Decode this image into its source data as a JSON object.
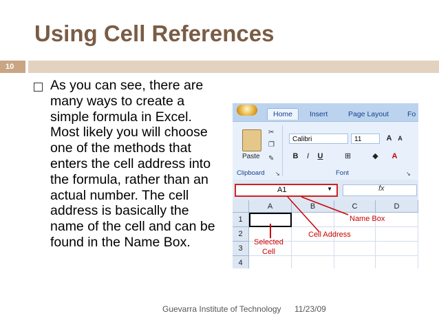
{
  "slide": {
    "title": "Using Cell References",
    "number": "10",
    "body": "As you can see, there are many ways to create a simple formula in Excel. Most likely you will choose one of the methods that enters the cell address into the formula, rather than an actual number. The cell address is basically the name of the cell and can be found in the Name Box.",
    "footer_org": "Guevarra Institute of Technology",
    "footer_date": "11/23/09"
  },
  "colors": {
    "title": "#7a5c45",
    "accent_dark": "#c9a584",
    "accent_light": "#e3d2c0",
    "annotation": "#cc0000"
  },
  "excel": {
    "tabs": [
      "Home",
      "Insert",
      "Page Layout",
      "Fo"
    ],
    "paste_label": "Paste",
    "clipboard_label": "Clipboard",
    "font_label": "Font",
    "font_name": "Calibri",
    "font_size": "11",
    "name_box_value": "A1",
    "fx_label": "fx",
    "columns": [
      "A",
      "B",
      "C",
      "D"
    ],
    "rows": [
      "1",
      "2",
      "3",
      "4"
    ],
    "annotations": {
      "name_box": "Name Box",
      "cell_address": "Cell Address",
      "selected_cell_1": "Selected",
      "selected_cell_2": "Cell"
    }
  }
}
